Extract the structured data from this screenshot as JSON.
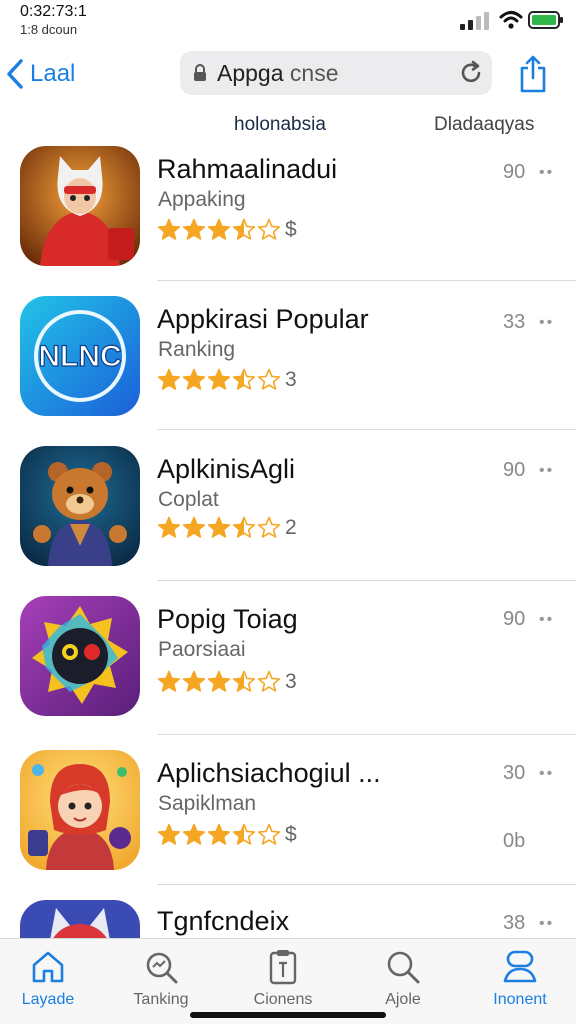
{
  "status": {
    "time": "0:32:73:1",
    "sub": "1:8 dcoun"
  },
  "nav": {
    "back_label": "Laal",
    "url_main": "Appga",
    "url_rest": "cnse"
  },
  "segments": {
    "active": "holonabsia",
    "inactive": "Dladaaqyas"
  },
  "apps": [
    {
      "title": "Rahmaalinadui",
      "subtitle": "Appaking",
      "rating": 3.5,
      "count": "$",
      "rank": "90",
      "extra": ""
    },
    {
      "title": "Appkirasi Popular",
      "subtitle": "Ranking",
      "rating": 3.5,
      "count": "3",
      "rank": "33",
      "extra": ""
    },
    {
      "title": "AplkinisAgli",
      "subtitle": "Coplat",
      "rating": 3.5,
      "count": "2",
      "rank": "90",
      "extra": ""
    },
    {
      "title": "Popig Toiag",
      "subtitle": "Paorsiaai",
      "rating": 3.5,
      "count": "3",
      "rank": "90",
      "extra": ""
    },
    {
      "title": "Aplichsiachogiul ...",
      "subtitle": "Sapiklman",
      "rating": 3.5,
      "count": "$",
      "rank": "30",
      "extra": "0b"
    },
    {
      "title": "Tgnfcndeix",
      "subtitle": "",
      "rating": 0,
      "count": "",
      "rank": "38",
      "extra": ""
    }
  ],
  "tabs": [
    {
      "label": "Layade",
      "icon": "home-icon",
      "active": true
    },
    {
      "label": "Tanking",
      "icon": "ranking-search-icon",
      "active": false
    },
    {
      "label": "Cionens",
      "icon": "clipboard-icon",
      "active": false
    },
    {
      "label": "Ajole",
      "icon": "search-icon",
      "active": false
    },
    {
      "label": "Inonent",
      "icon": "account-icon",
      "active": false
    }
  ],
  "colors": {
    "accent": "#1a7fe0",
    "star": "#f5a623",
    "battery": "#2fb54a"
  }
}
